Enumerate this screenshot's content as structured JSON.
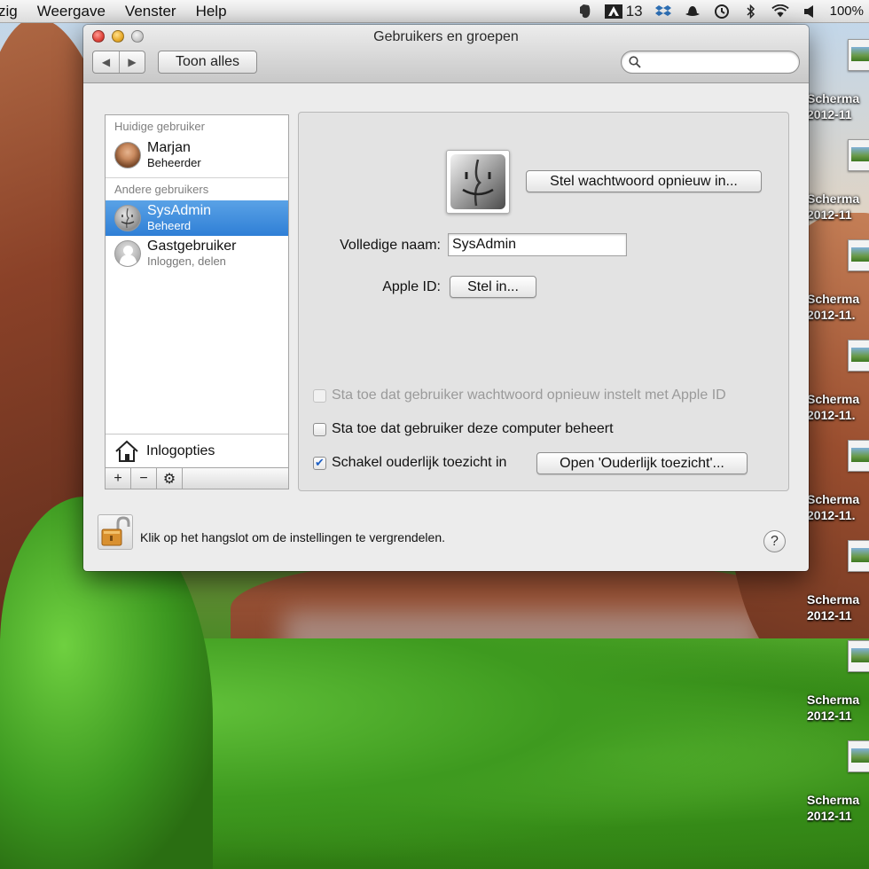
{
  "menubar": {
    "items": [
      "zig",
      "Weergave",
      "Venster",
      "Help"
    ],
    "status": {
      "badge_count": "13",
      "battery": "100%",
      "icons": [
        "evernote-icon",
        "adobe-icon",
        "dropbox-icon",
        "spy-icon",
        "time-machine-icon",
        "bluetooth-icon",
        "wifi-icon",
        "volume-icon"
      ]
    }
  },
  "window": {
    "title": "Gebruikers en groepen",
    "toolbar": {
      "back_glyph": "◀",
      "forward_glyph": "▶",
      "show_all_label": "Toon alles",
      "search_placeholder": ""
    }
  },
  "sidebar": {
    "current_header": "Huidige gebruiker",
    "current_user": {
      "name": "Marjan",
      "role": "Beheerder"
    },
    "others_header": "Andere gebruikers",
    "other_users": [
      {
        "name": "SysAdmin",
        "role": "Beheerd",
        "selected": true
      },
      {
        "name": "Gastgebruiker",
        "role": "Inloggen, delen",
        "selected": false
      }
    ],
    "login_options_label": "Inlogopties",
    "toolbar": {
      "add": "+",
      "remove": "−",
      "action": "⚙"
    }
  },
  "detail": {
    "reset_password_label": "Stel wachtwoord opnieuw in...",
    "full_name_label": "Volledige naam:",
    "full_name_value": "SysAdmin",
    "apple_id_label": "Apple ID:",
    "apple_id_button": "Stel in...",
    "checkboxes": [
      {
        "label": "Sta toe dat gebruiker wachtwoord opnieuw instelt met Apple ID",
        "checked": false,
        "enabled": false
      },
      {
        "label": "Sta toe dat gebruiker deze computer beheert",
        "checked": false,
        "enabled": true
      },
      {
        "label": "Schakel ouderlijk toezicht in",
        "checked": true,
        "enabled": true
      }
    ],
    "parental_button": "Open 'Ouderlijk toezicht'..."
  },
  "footer": {
    "lock_text": "Klik op het hangslot om de instellingen te vergrendelen.",
    "help_label": "?"
  },
  "desktop": {
    "icons": [
      {
        "line1": "Scherma",
        "line2": "2012-11"
      },
      {
        "line1": "Scherma",
        "line2": "2012-11"
      },
      {
        "line1": "Scherma",
        "line2": "2012-11."
      },
      {
        "line1": "Scherma",
        "line2": "2012-11."
      },
      {
        "line1": "Scherma",
        "line2": "2012-11."
      },
      {
        "line1": "Scherma",
        "line2": "2012-11"
      },
      {
        "line1": "Scherma",
        "line2": "2012-11"
      },
      {
        "line1": "Scherma",
        "line2": "2012-11"
      }
    ]
  },
  "colors": {
    "selection": "#2f7fd6",
    "checkbox_check": "#1d5fc4"
  }
}
